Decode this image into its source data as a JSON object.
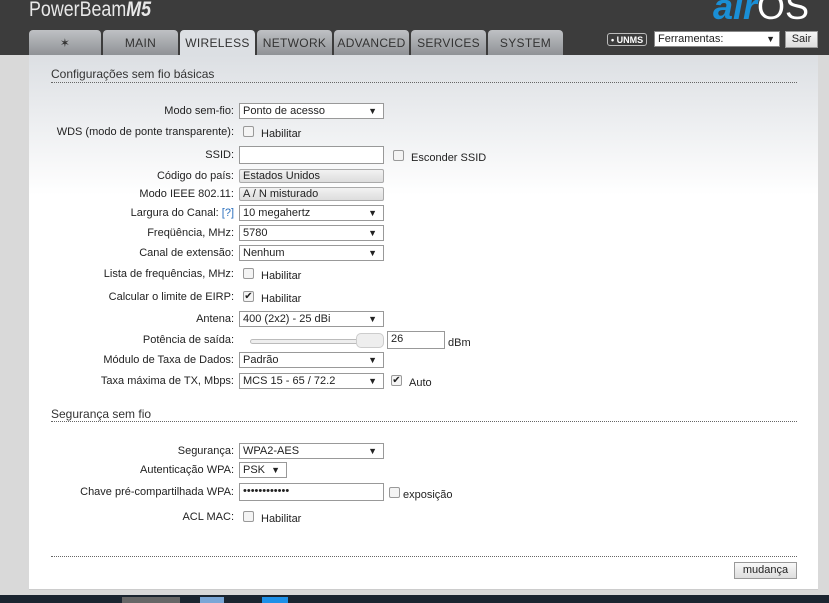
{
  "header": {
    "brand": "PowerBeam",
    "brand_model": "M5",
    "logo_air": "air",
    "logo_os": "OS"
  },
  "tabs": [
    {
      "label": ""
    },
    {
      "label": "MAIN"
    },
    {
      "label": "WIRELESS"
    },
    {
      "label": "NETWORK"
    },
    {
      "label": "ADVANCED"
    },
    {
      "label": "SERVICES"
    },
    {
      "label": "SYSTEM"
    }
  ],
  "topbar": {
    "unms": "• UNMS",
    "tools": "Ferramentas:",
    "logout": "Sair"
  },
  "basic": {
    "title": "Configurações sem fio básicas",
    "mode_label": "Modo sem-fio:",
    "mode_value": "Ponto de acesso",
    "wds_label": "WDS (modo de ponte transparente):",
    "enable": "Habilitar",
    "ssid_label": "SSID:",
    "ssid_value": "",
    "hide_ssid": "Esconder SSID",
    "country_label": "Código do país:",
    "country_value": "Estados Unidos",
    "ieee_label": "Modo IEEE 802.11:",
    "ieee_value": "A / N misturado",
    "width_label": "Largura do Canal:",
    "help": "[?]",
    "width_value": "10 megahertz",
    "freq_label": "Freqüência, MHz:",
    "freq_value": "5780",
    "ext_label": "Canal de extensão:",
    "ext_value": "Nenhum",
    "freqlist_label": "Lista de frequências, MHz:",
    "eirp_label": "Calcular o limite de EIRP:",
    "antenna_label": "Antena:",
    "antenna_value": "400 (2x2) - 25 dBi",
    "power_label": "Potência de saída:",
    "power_value": "26",
    "power_unit": "dBm",
    "power_fraction": 0.92,
    "rate_module_label": "Módulo de Taxa de Dados:",
    "rate_module_value": "Padrão",
    "maxrate_label": "Taxa máxima de TX, Mbps:",
    "maxrate_value": "MCS 15 - 65 / 72.2",
    "auto": "Auto"
  },
  "security": {
    "title": "Segurança sem fio",
    "sec_label": "Segurança:",
    "sec_value": "WPA2-AES",
    "auth_label": "Autenticação WPA:",
    "auth_value": "PSK",
    "key_label": "Chave pré-compartilhada WPA:",
    "key_value": "••••••••••••",
    "show": "exposição",
    "acl_label": "ACL MAC:",
    "enable": "Habilitar"
  },
  "actions": {
    "change": "mudança"
  }
}
